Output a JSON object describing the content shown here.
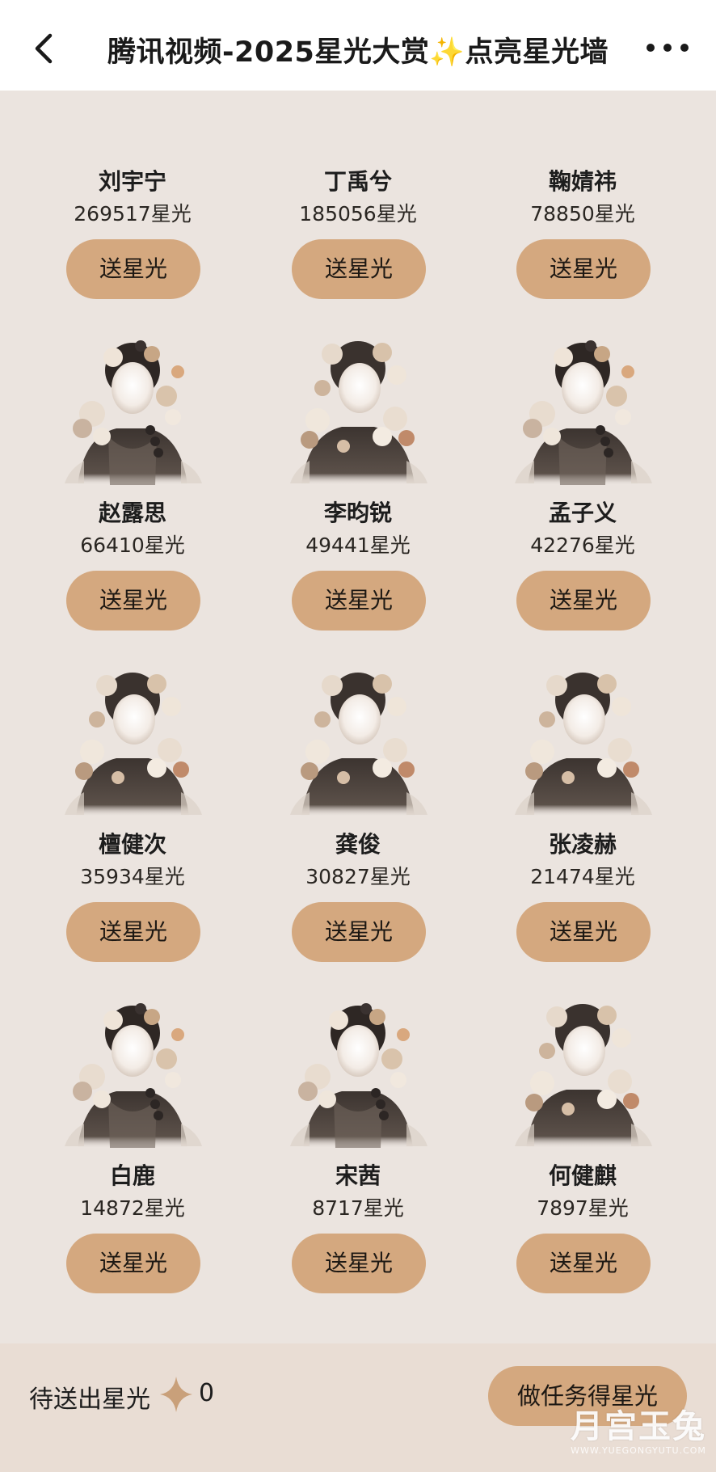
{
  "header": {
    "title_prefix": "腾讯视频-2025星光大赏",
    "title_spark": "✨",
    "title_suffix": "点亮星光墙"
  },
  "send_label": "送星光",
  "stars_unit": "星光",
  "celebrities": [
    {
      "name": "刘宇宁",
      "stars": "269517星光"
    },
    {
      "name": "丁禹兮",
      "stars": "185056星光"
    },
    {
      "name": "鞠婧祎",
      "stars": "78850星光"
    },
    {
      "name": "赵露思",
      "stars": "66410星光"
    },
    {
      "name": "李昀锐",
      "stars": "49441星光"
    },
    {
      "name": "孟子义",
      "stars": "42276星光"
    },
    {
      "name": "檀健次",
      "stars": "35934星光"
    },
    {
      "name": "龚俊",
      "stars": "30827星光"
    },
    {
      "name": "张凌赫",
      "stars": "21474星光"
    },
    {
      "name": "白鹿",
      "stars": "14872星光"
    },
    {
      "name": "宋茜",
      "stars": "8717星光"
    },
    {
      "name": "何健麒",
      "stars": "7897星光"
    }
  ],
  "footer": {
    "pending_label": "待送出星光",
    "pending_count": "0",
    "task_button": "做任务得星光"
  },
  "watermark": {
    "main": "月宫玉兔",
    "sub": "WWW.YUEGONGYUTU.COM"
  },
  "colors": {
    "background": "#ebe4df",
    "button": "#d4a87f",
    "footer": "#e9ddd4"
  }
}
